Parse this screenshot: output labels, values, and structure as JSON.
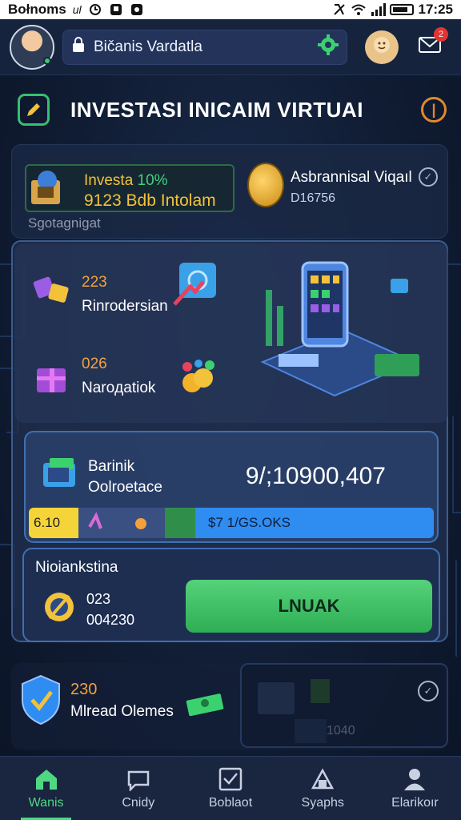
{
  "status_bar": {
    "left_text": "Bołnoms",
    "left_mark": "ul",
    "time": "17:25"
  },
  "header": {
    "search_text": "Bičanis Vardatla",
    "mail_badge": "2"
  },
  "title": {
    "text": "INVESTASI INICAIM VIRTUAI"
  },
  "summary": {
    "invest_label": "Investa",
    "invest_pct": "10%",
    "invest_amount": "9123 Bdb Intolam",
    "asset_title": "Asbrannisal Viqaıl",
    "asset_value": "D16756",
    "footer": "Sgotagnigat"
  },
  "stats": [
    {
      "num": "223",
      "label": "Rinrodersian"
    },
    {
      "num": "026",
      "label": "Naroдatiok"
    }
  ],
  "balance": {
    "line1": "Barinik",
    "line2": "Oolroetace",
    "amount": "9/;10900,407",
    "bar_left": "6.10",
    "bar_right": "$7 1/GS.OKS"
  },
  "action": {
    "title": "Nioiankstina",
    "num1": "023",
    "num2": "004230",
    "button_label": "LNUAK"
  },
  "lower": {
    "num": "230",
    "label": "Mlread Olemes",
    "dim_value": "1040"
  },
  "nav": [
    {
      "label": "Wanis",
      "icon": "home-icon"
    },
    {
      "label": "Cnidy",
      "icon": "chat-icon"
    },
    {
      "label": "Boblaot",
      "icon": "chart-icon"
    },
    {
      "label": "Syaphs",
      "icon": "graph-icon"
    },
    {
      "label": "Elarikoır",
      "icon": "profile-icon"
    }
  ],
  "colors": {
    "accent_green": "#4fd883",
    "accent_orange": "#f2a23b",
    "accent_yellow": "#f2c23b",
    "panel_border": "#3f70b0"
  }
}
